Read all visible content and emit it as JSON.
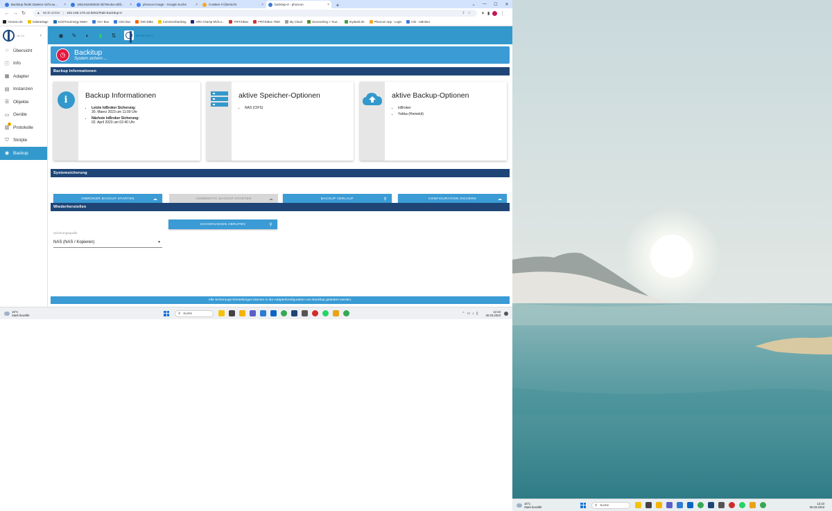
{
  "browser": {
    "tabs": [
      {
        "label": "Backitup findet Dateien nicht au...",
        "active": false,
        "color": "#3c78d8"
      },
      {
        "label": "1651462260533-3b76ec5a-15fd...",
        "active": false,
        "color": "#3c78d8"
      },
      {
        "label": "phoscon image - Google Suche",
        "active": false,
        "color": "#4285f4"
      },
      {
        "label": "ConBee II Übersicht",
        "active": false,
        "color": "#f5a623"
      },
      {
        "label": "backitup-0 - phoscon",
        "active": true,
        "color": "#3c78d8"
      }
    ],
    "address": {
      "security": "Nicht sicher",
      "url": "192.168.178.42:8081/#tab-backitup-0"
    },
    "bookmarks": [
      {
        "label": "Amazon.de",
        "color": "#222"
      },
      {
        "label": "Solaranlage",
        "color": "#f4c20d"
      },
      {
        "label": "KOSTALEnergy Meter",
        "color": "#1f6fb2"
      },
      {
        "label": "VU+ Box",
        "color": "#3c78d8"
      },
      {
        "label": "OS2 Box",
        "color": "#3c78d8"
      },
      {
        "label": "ING-DiBa",
        "color": "#ff6200"
      },
      {
        "label": "Commerzbanking",
        "color": "#f5c400"
      },
      {
        "label": "ARV Champ MV/Lo...",
        "color": "#1a237e"
      },
      {
        "label": "FRITZ!Box",
        "color": "#d32f2f"
      },
      {
        "label": "FRITZ!Box 7530",
        "color": "#d32f2f"
      },
      {
        "label": "My Cloud",
        "color": "#9e9e9e"
      },
      {
        "label": "Geocaching > Your...",
        "color": "#558b2f"
      },
      {
        "label": "mydealz.de",
        "color": "#43a047"
      },
      {
        "label": "Phoscon App - Login",
        "color": "#f5a623"
      },
      {
        "label": "info - ioBroker",
        "color": "#3c78d8"
      }
    ]
  },
  "sidebar": {
    "version": "v6.3.5",
    "items": [
      {
        "label": "Übersicht",
        "icon": "grid-icon",
        "active": false
      },
      {
        "label": "Info",
        "icon": "info-icon",
        "active": false
      },
      {
        "label": "Adapter",
        "icon": "store-icon",
        "active": false
      },
      {
        "label": "Instanzen",
        "icon": "instances-icon",
        "active": false
      },
      {
        "label": "Objekte",
        "icon": "objects-icon",
        "active": false
      },
      {
        "label": "Geräte",
        "icon": "devices-icon",
        "active": false
      },
      {
        "label": "Protokolle",
        "icon": "logs-icon",
        "active": false,
        "badge": "1"
      },
      {
        "label": "Skripte",
        "icon": "scripts-icon",
        "active": false
      },
      {
        "label": "Backup",
        "icon": "backup-icon",
        "active": true
      }
    ]
  },
  "topbar": {
    "tab_label": "BACKUP-0"
  },
  "page": {
    "title": "Backitup",
    "subtitle": "System sichern ...",
    "section_info": "Backup Informationen",
    "section_system": "Systemsicherung",
    "section_restore": "Wiederherstellen",
    "cards": [
      {
        "title": "Backup Informationen",
        "items": [
          {
            "label": "Letzte IoBroker Sicherung:",
            "value": "30. Maerz 2023 um 11:09 Uhr"
          },
          {
            "label": "Nächste IoBroker Sicherung:",
            "value": "02. April 2023 um 02:40 Uhr"
          }
        ]
      },
      {
        "title": "aktive Speicher-Optionen",
        "items": [
          {
            "label": "",
            "value": "NAS (CIFS)"
          }
        ]
      },
      {
        "title": "aktive Backup-Optionen",
        "items": [
          {
            "label": "",
            "value": "ioBroker"
          },
          {
            "label": "",
            "value": "Yahka (Homekit)"
          }
        ]
      }
    ],
    "buttons": {
      "iobroker_backup": "IOBROKER BACKUP STARTEN",
      "homematic_backup": "HOMEMATIC BACKUP STARTEN",
      "backup_history": "BACKUP VERLAUF",
      "save_config": "KONFIGURATION SICHERN",
      "fetch_backups": "SICHERUNGEN ABRUFEN"
    },
    "restore": {
      "source_label": "Sicherungsquelle",
      "source_value": "NAS (NAS / Kopieren)"
    },
    "footer_note": "Alle Sicherungs Einstellungen können in der Adapterkonfiguration von Backitup geändert werden."
  },
  "taskbar": {
    "temperature": "15°C",
    "weather": "Stark bewölkt",
    "search": "Suche",
    "time": "12:23",
    "date": "30.03.2023"
  },
  "colors": {
    "accent": "#3399cc",
    "section": "#1e4576",
    "backup_red": "#e5173f"
  }
}
